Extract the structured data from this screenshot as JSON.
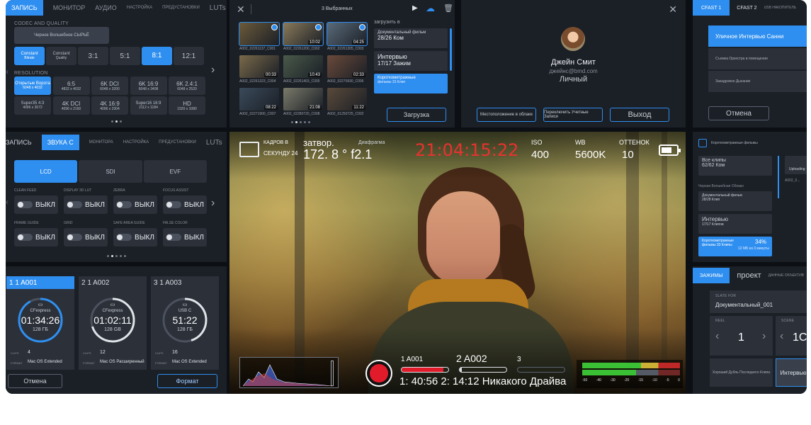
{
  "colors": {
    "accent": "#2f8ff0",
    "record": "#e21b2a",
    "timecode": "#e8322f",
    "meter_green": "#3fd43a"
  },
  "recording_panel": {
    "tabs": [
      "ЗАПИСЬ",
      "МОНИТОР",
      "АУДИО",
      "НАСТРОЙКА",
      "ПРЕДУСТАНОВКИ",
      "LUTs"
    ],
    "active_tab": 0,
    "section_codec": "CODEC AND QUALITY",
    "codec_label": "Черное Волшебное СЫРЬЁ",
    "quality": [
      {
        "main": "Constant",
        "sub": "Bitrate",
        "active": true
      },
      {
        "main": "Constant",
        "sub": "Quality",
        "active": false
      },
      {
        "main": "3:1",
        "sub": "",
        "active": false
      },
      {
        "main": "5:1",
        "sub": "",
        "active": false
      },
      {
        "main": "8:1",
        "sub": "",
        "active": true
      },
      {
        "main": "12:1",
        "sub": "",
        "active": false
      }
    ],
    "section_resolution": "RESOLUTION",
    "resolutions": [
      {
        "main": "Открытые Ворота",
        "sub": "6048 x 4032",
        "active": true
      },
      {
        "main": "6:5",
        "sub": "4832 x 4032",
        "active": false
      },
      {
        "main": "6K DCI",
        "sub": "6048 x 3200",
        "active": false
      },
      {
        "main": "6K 16:9",
        "sub": "6048 x 3408",
        "active": false
      },
      {
        "main": "6K 2.4:1",
        "sub": "6048 x 2520",
        "active": false
      },
      {
        "main": "Super35 4:3",
        "sub": "4096 x 3072",
        "active": false
      },
      {
        "main": "4K DCI",
        "sub": "4096 x 2160",
        "active": false
      },
      {
        "main": "4K 16:9",
        "sub": "4096 x 2304",
        "active": false
      },
      {
        "main": "Super16 16:9",
        "sub": "2112 x 1184",
        "active": false
      },
      {
        "main": "HD",
        "sub": "1920 x 1080",
        "active": false
      }
    ]
  },
  "monitor_panel": {
    "tabs": [
      "ЗАПИСЬ",
      "ЗВУКА С",
      "МОНИТОРА",
      "НАСТРОЙКА",
      "ПРЕДУСТАНОВКИ",
      "LUTs"
    ],
    "outputs": [
      "LCD",
      "SDI",
      "EVF"
    ],
    "options": [
      {
        "label": "CLEAN FEED",
        "value": "ВЫКЛ"
      },
      {
        "label": "DISPLAY 3D LUT",
        "value": "ВЫКЛ"
      },
      {
        "label": "ZEBRA",
        "value": "ВЫКЛ"
      },
      {
        "label": "FOCUS ASSIST",
        "value": "ВЫКЛ"
      },
      {
        "label": "FRAME GUIDE",
        "value": "ВЫКЛ"
      },
      {
        "label": "GRID",
        "value": "ВЫКЛ"
      },
      {
        "label": "SAFE AREA GUIDE",
        "value": "ВЫКЛ"
      },
      {
        "label": "FALSE COLOR",
        "value": "ВЫКЛ"
      }
    ]
  },
  "media_panel": {
    "cards": [
      {
        "slot": "1 1 A001",
        "type": "CFexpress",
        "time": "01:34:26",
        "size": "128 ГБ",
        "clips": "4",
        "format": "Mac OS Extended",
        "fill": 0.92,
        "active": true
      },
      {
        "slot": "2 1 A002",
        "type": "CFexpress",
        "time": "01:02:11",
        "size": "128 GB",
        "clips": "12",
        "format": "Mac OS Расширенный",
        "fill": 0.7,
        "active": false
      },
      {
        "slot": "3 1 A003",
        "type": "USB C",
        "time": "51:22",
        "size": "128 ГБ",
        "clips": "16",
        "format": "Mac OS Extended",
        "fill": 0.45,
        "active": false
      }
    ],
    "clips_label": "CLIPS",
    "format_label": "FORMAT",
    "cancel": "Отмена",
    "format_button": "Формат"
  },
  "upload_panel": {
    "selected": "3 Выбранных",
    "upload_to": "загрузить в",
    "clips": [
      {
        "name": "A002_02261137_C001",
        "dur": "",
        "sel": true
      },
      {
        "name": "A002_02261200_C002",
        "dur": "10:02",
        "sel": true
      },
      {
        "name": "A002_02261305_C003",
        "dur": "04:25",
        "sel": true
      },
      {
        "name": "A002_02261323_C004",
        "dur": "00:33",
        "sel": false
      },
      {
        "name": "A002_02261403_C005",
        "dur": "10:43",
        "sel": false
      },
      {
        "name": "A002_02270930_C006",
        "dur": "02:33",
        "sel": false
      },
      {
        "name": "A002_02271900_C007",
        "dur": "08:22",
        "sel": false
      },
      {
        "name": "A002_02280720_C008",
        "dur": "21:08",
        "sel": false
      },
      {
        "name": "A002_01250725_C002",
        "dur": "11:22",
        "sel": false
      }
    ],
    "destinations": [
      {
        "name": "Документальный фильм",
        "count": "28/26 Ком",
        "active": false
      },
      {
        "name": "Интервью",
        "count": "17/17 Зажим",
        "active": false
      },
      {
        "name": "Короткометражные",
        "count": "фильмы 33 Клип",
        "active": true
      }
    ],
    "upload_button": "Загрузка"
  },
  "account_panel": {
    "name": "Джейн Смит",
    "email": "джейнс@bmd.com",
    "type": "Личный",
    "storage_button": "Местоположение в облаке",
    "switch_button": "Переключить Учетные Записи",
    "logout_button": "Выход"
  },
  "viewfinder": {
    "fps_label": "КАДРОВ В",
    "fps_value": "СЕКУНДУ 24",
    "shutter_label": "затвор.",
    "aperture_label": "Диафрагма",
    "shutter_value": "172. 8 ° f2.1",
    "timecode": "21:04:15:22",
    "iso_label": "ISO",
    "iso_value": "400",
    "wb_label": "WB",
    "wb_value": "5600K",
    "tint_label": "ОТТЕНОК",
    "tint_value": "10",
    "slots": [
      "1 A001",
      "2 A002",
      "3"
    ],
    "slot_fill": [
      0.9,
      0.05,
      0
    ],
    "remaining": "1: 40:56 2: 14:12 Никакого Драйва",
    "meter_ticks": [
      "-50",
      "-40",
      "-30",
      "-20",
      "-15",
      "-10",
      "-5",
      "0"
    ]
  },
  "cfast_panel": {
    "tabs": [
      "CFAST 1",
      "CFAST 2",
      "USB НАКОПИТЕЛЬ"
    ],
    "items": [
      "Уличное Интервью Санни",
      "Съемка Оркестра в помещении",
      "Закадровое Дыхание"
    ],
    "cancel": "Отмена"
  },
  "library_panel": {
    "title": "Короткометражные фильмы",
    "all_clips": "Все клипы",
    "all_count": "62/62 Ком",
    "project_heading": "Черная Волшебная Облако",
    "items": [
      {
        "name": "Документальный фильм",
        "count": "28/28 Клип",
        "active": false
      },
      {
        "name": "Интервью",
        "count": "17/17 Клипов",
        "active": false
      },
      {
        "name": "Короткометражные",
        "count": "фильмы 33 Клипы",
        "active": true
      }
    ],
    "upload_percent": "34%",
    "upload_detail": "12 МБ из 3 минуты",
    "side_label": "Uploading",
    "side_clip": "A002_0..."
  },
  "slate_panel": {
    "tabs": [
      "ЗАЖИМЫ",
      "проект",
      "ДАННЫЕ ОБЪЕКТИВ"
    ],
    "slate_for_label": "SLATE FOR",
    "slate_for_value": "Документальный_001",
    "reel_label": "REEL",
    "reel_value": "1",
    "scene_label": "SCENE",
    "scene_value": "1C",
    "shot_label": "Хороший Дубль Последнего Клипа",
    "interview": "Интервью"
  }
}
